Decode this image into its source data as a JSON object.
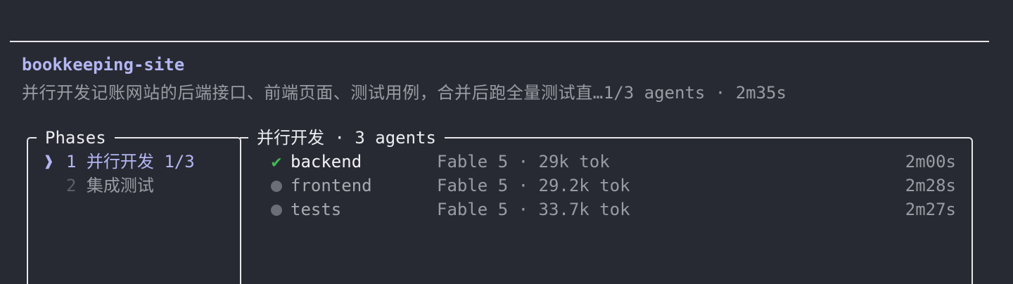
{
  "header": {
    "title": "bookkeeping-site",
    "description": "并行开发记账网站的后端接口、前端页面、测试用例，合并后跑全量测试直…",
    "status": "1/3 agents · 2m35s"
  },
  "phases": {
    "title": "Phases",
    "items": [
      {
        "marker": "❱",
        "number": "1",
        "label": "并行开发",
        "progress": "1/3",
        "active": true
      },
      {
        "marker": "",
        "number": "2",
        "label": "集成测试",
        "progress": "",
        "active": false
      }
    ]
  },
  "agents_panel": {
    "title": "并行开发 · 3 agents",
    "agents": [
      {
        "status": "done",
        "status_icon": "check-icon",
        "status_glyph": "✔",
        "name": "backend",
        "meta": "Fable 5 · 29k tok",
        "time": "2m00s"
      },
      {
        "status": "pending",
        "status_icon": "dot-icon",
        "status_glyph": "",
        "name": "frontend",
        "meta": "Fable 5 · 29.2k tok",
        "time": "2m28s"
      },
      {
        "status": "pending",
        "status_icon": "dot-icon",
        "status_glyph": "",
        "name": "tests",
        "meta": "Fable 5 · 33.7k tok",
        "time": "2m27s"
      }
    ]
  },
  "colors": {
    "background": "#282a33",
    "accent": "#b3b6f2",
    "success": "#3fb950",
    "muted": "#9a9ca4"
  }
}
